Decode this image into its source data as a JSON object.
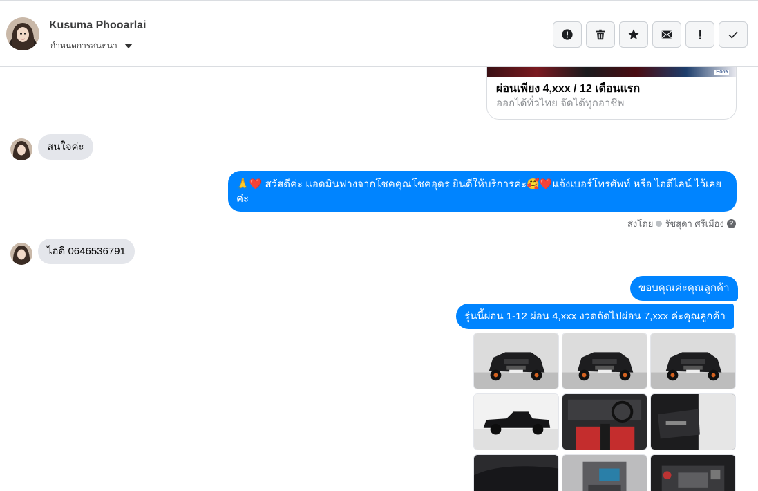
{
  "header": {
    "name": "Kusuma Phooarlai",
    "manage_label": "กำหนดการสนทนา"
  },
  "actions": [
    {
      "name": "report-icon",
      "glyph": "!"
    },
    {
      "name": "trash-icon"
    },
    {
      "name": "star-icon"
    },
    {
      "name": "mail-icon"
    },
    {
      "name": "exclamation-icon",
      "glyph": "!"
    },
    {
      "name": "checkmark-icon"
    }
  ],
  "ad_card": {
    "title": "ผ่อนเพียง 4,xxx / 12 เดือนแรก",
    "subtitle": "ออกได้ทั่วไทย จัดได้ทุกอาชีพ",
    "image_tag": "H069"
  },
  "messages": {
    "incoming_1": "สนใจค่ะ",
    "outgoing_1": "🙏❤️ สวัสดีค่ะ แอดมินฟางจากโชคคุณโชคอุดร ยินดีให้บริการค่ะ🥰❤️แจ้งเบอร์โทรศัพท์ หรือ ไอดีไลน์  ไว้เลยค่ะ",
    "sent_by_label": "ส่งโดย",
    "sent_by_name": "รัชสุดา ศรีเมือง",
    "incoming_2": "ไอดี 0646536791",
    "outgoing_2": "ขอบคุณค่ะคุณลูกค้า",
    "outgoing_3": "รุ่นนี้ผ่อน 1-12 ผ่อน 4,xxx งวดถัดไปผ่อน 7,xxx ค่ะคุณลูกค้า"
  },
  "photos": [
    {
      "name": "photo-truck-front-left",
      "kind": "front"
    },
    {
      "name": "photo-truck-front",
      "kind": "front"
    },
    {
      "name": "photo-truck-front-right",
      "kind": "front"
    },
    {
      "name": "photo-truck-side",
      "kind": "side"
    },
    {
      "name": "photo-interior-dashboard",
      "kind": "interior"
    },
    {
      "name": "photo-door-interior",
      "kind": "door"
    },
    {
      "name": "photo-wheel-arch",
      "kind": "dark"
    },
    {
      "name": "photo-center-console",
      "kind": "console"
    },
    {
      "name": "photo-engine-bay",
      "kind": "engine"
    }
  ],
  "colors": {
    "accent": "#0084ff",
    "incoming_bubble": "#e4e6eb"
  }
}
